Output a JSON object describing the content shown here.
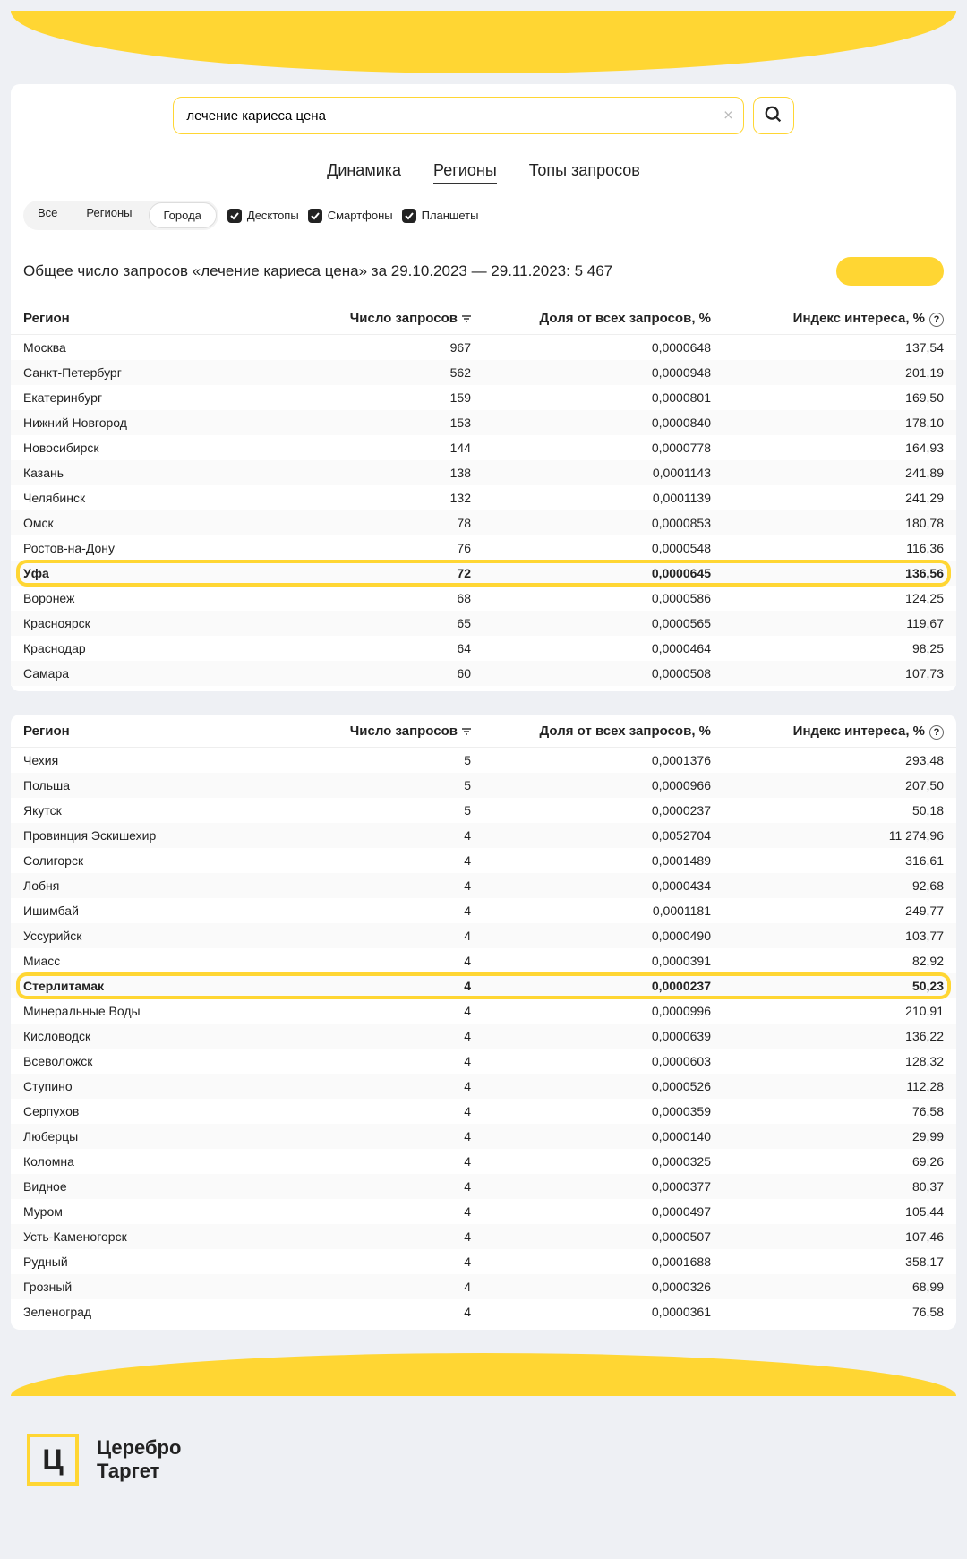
{
  "search": {
    "value": "лечение кариеса цена"
  },
  "mainTabs": {
    "t1": "Динамика",
    "t2": "Регионы",
    "t3": "Топы запросов"
  },
  "seg": {
    "all": "Все",
    "regions": "Регионы",
    "cities": "Города"
  },
  "chk": {
    "desktop": "Десктопы",
    "smart": "Смартфоны",
    "tablet": "Планшеты"
  },
  "summary": "Общее число запросов «лечение кариеса цена» за 29.10.2023 — 29.11.2023: 5 467",
  "head": {
    "region": "Регион",
    "count": "Число запросов",
    "share": "Доля от всех запросов, %",
    "index": "Индекс интереса, %"
  },
  "rows1": [
    {
      "r": "Москва",
      "c": "967",
      "s": "0,0000648",
      "i": "137,54"
    },
    {
      "r": "Санкт-Петербург",
      "c": "562",
      "s": "0,0000948",
      "i": "201,19"
    },
    {
      "r": "Екатеринбург",
      "c": "159",
      "s": "0,0000801",
      "i": "169,50"
    },
    {
      "r": "Нижний Новгород",
      "c": "153",
      "s": "0,0000840",
      "i": "178,10"
    },
    {
      "r": "Новосибирск",
      "c": "144",
      "s": "0,0000778",
      "i": "164,93"
    },
    {
      "r": "Казань",
      "c": "138",
      "s": "0,0001143",
      "i": "241,89"
    },
    {
      "r": "Челябинск",
      "c": "132",
      "s": "0,0001139",
      "i": "241,29"
    },
    {
      "r": "Омск",
      "c": "78",
      "s": "0,0000853",
      "i": "180,78"
    },
    {
      "r": "Ростов-на-Дону",
      "c": "76",
      "s": "0,0000548",
      "i": "116,36"
    },
    {
      "r": "Уфа",
      "c": "72",
      "s": "0,0000645",
      "i": "136,56",
      "hl": true
    },
    {
      "r": "Воронеж",
      "c": "68",
      "s": "0,0000586",
      "i": "124,25"
    },
    {
      "r": "Красноярск",
      "c": "65",
      "s": "0,0000565",
      "i": "119,67"
    },
    {
      "r": "Краснодар",
      "c": "64",
      "s": "0,0000464",
      "i": "98,25"
    },
    {
      "r": "Самара",
      "c": "60",
      "s": "0,0000508",
      "i": "107,73"
    }
  ],
  "rows2": [
    {
      "r": "Чехия",
      "c": "5",
      "s": "0,0001376",
      "i": "293,48"
    },
    {
      "r": "Польша",
      "c": "5",
      "s": "0,0000966",
      "i": "207,50"
    },
    {
      "r": "Якутск",
      "c": "5",
      "s": "0,0000237",
      "i": "50,18"
    },
    {
      "r": "Провинция Эскишехир",
      "c": "4",
      "s": "0,0052704",
      "i": "11 274,96"
    },
    {
      "r": "Солигорск",
      "c": "4",
      "s": "0,0001489",
      "i": "316,61"
    },
    {
      "r": "Лобня",
      "c": "4",
      "s": "0,0000434",
      "i": "92,68"
    },
    {
      "r": "Ишимбай",
      "c": "4",
      "s": "0,0001181",
      "i": "249,77"
    },
    {
      "r": "Уссурийск",
      "c": "4",
      "s": "0,0000490",
      "i": "103,77"
    },
    {
      "r": "Миасс",
      "c": "4",
      "s": "0,0000391",
      "i": "82,92"
    },
    {
      "r": "Стерлитамак",
      "c": "4",
      "s": "0,0000237",
      "i": "50,23",
      "hl": true
    },
    {
      "r": "Минеральные Воды",
      "c": "4",
      "s": "0,0000996",
      "i": "210,91"
    },
    {
      "r": "Кисловодск",
      "c": "4",
      "s": "0,0000639",
      "i": "136,22"
    },
    {
      "r": "Всеволожск",
      "c": "4",
      "s": "0,0000603",
      "i": "128,32"
    },
    {
      "r": "Ступино",
      "c": "4",
      "s": "0,0000526",
      "i": "112,28"
    },
    {
      "r": "Серпухов",
      "c": "4",
      "s": "0,0000359",
      "i": "76,58"
    },
    {
      "r": "Люберцы",
      "c": "4",
      "s": "0,0000140",
      "i": "29,99"
    },
    {
      "r": "Коломна",
      "c": "4",
      "s": "0,0000325",
      "i": "69,26"
    },
    {
      "r": "Видное",
      "c": "4",
      "s": "0,0000377",
      "i": "80,37"
    },
    {
      "r": "Муром",
      "c": "4",
      "s": "0,0000497",
      "i": "105,44"
    },
    {
      "r": "Усть-Каменогорск",
      "c": "4",
      "s": "0,0000507",
      "i": "107,46"
    },
    {
      "r": "Рудный",
      "c": "4",
      "s": "0,0001688",
      "i": "358,17"
    },
    {
      "r": "Грозный",
      "c": "4",
      "s": "0,0000326",
      "i": "68,99"
    },
    {
      "r": "Зеленоград",
      "c": "4",
      "s": "0,0000361",
      "i": "76,58"
    }
  ],
  "footer": {
    "logo": "Ц",
    "line1": "Церебро",
    "line2": "Таргет"
  }
}
